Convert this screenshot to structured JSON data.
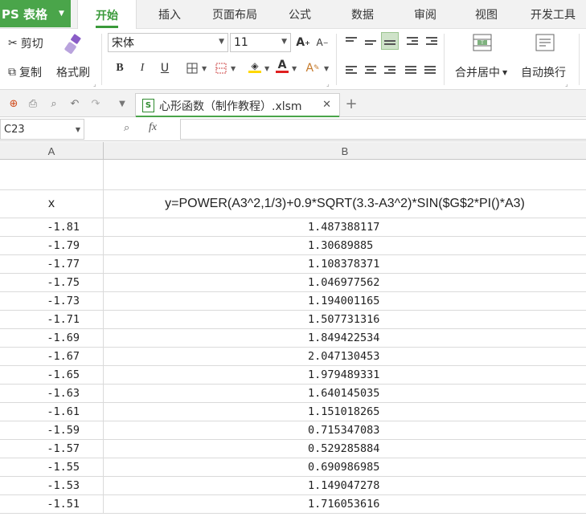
{
  "app": {
    "name": "PS 表格"
  },
  "menu": {
    "tabs": [
      {
        "label": "开始",
        "active": true
      },
      {
        "label": "插入"
      },
      {
        "label": "页面布局"
      },
      {
        "label": "公式"
      },
      {
        "label": "数据"
      },
      {
        "label": "审阅"
      },
      {
        "label": "视图"
      },
      {
        "label": "开发工具"
      }
    ]
  },
  "ribbon": {
    "cut_label": "剪切",
    "copy_label": "复制",
    "format_painter_label": "格式刷",
    "font_name": "宋体",
    "font_size": "11",
    "merge_center_label": "合并居中",
    "wrap_text_label": "自动换行",
    "accent_color": "#4aa54a",
    "font_color": "#e02020",
    "fill_color": "#ffd800"
  },
  "document_tab": {
    "title": "心形函数（制作教程）.xlsm"
  },
  "formula_bar": {
    "cell_ref": "C23",
    "fx_label": "fx",
    "content": ""
  },
  "sheet": {
    "columns": [
      "A",
      "B"
    ],
    "header_row": {
      "a": "x",
      "b": "y=POWER(A3^2,1/3)+0.9*SQRT(3.3-A3^2)*SIN($G$2*PI()*A3)"
    },
    "rows": [
      {
        "x": "-1.81",
        "y": "1.487388117"
      },
      {
        "x": "-1.79",
        "y": "1.30689885"
      },
      {
        "x": "-1.77",
        "y": "1.108378371"
      },
      {
        "x": "-1.75",
        "y": "1.046977562"
      },
      {
        "x": "-1.73",
        "y": "1.194001165"
      },
      {
        "x": "-1.71",
        "y": "1.507731316"
      },
      {
        "x": "-1.69",
        "y": "1.849422534"
      },
      {
        "x": "-1.67",
        "y": "2.047130453"
      },
      {
        "x": "-1.65",
        "y": "1.979489331"
      },
      {
        "x": "-1.63",
        "y": "1.640145035"
      },
      {
        "x": "-1.61",
        "y": "1.151018265"
      },
      {
        "x": "-1.59",
        "y": "0.715347083"
      },
      {
        "x": "-1.57",
        "y": "0.529285884"
      },
      {
        "x": "-1.55",
        "y": "0.690986985"
      },
      {
        "x": "-1.53",
        "y": "1.149047278"
      },
      {
        "x": "-1.51",
        "y": "1.716053616"
      }
    ]
  }
}
